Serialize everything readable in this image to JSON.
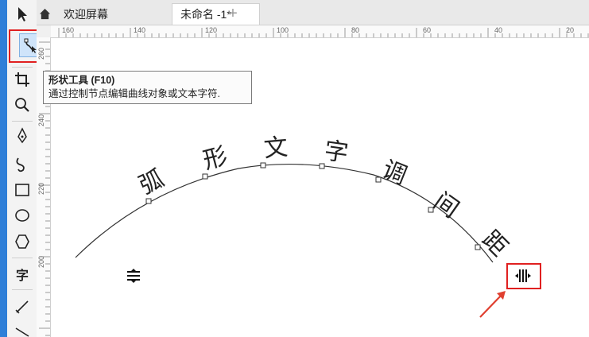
{
  "tabs": {
    "home_icon": "home-icon",
    "welcome": "欢迎屏幕",
    "untitled": "未命名 -1*",
    "add_icon": "plus-icon"
  },
  "ruler": {
    "horizontal_labels": [
      "160",
      "140",
      "120",
      "100",
      "80",
      "60",
      "40",
      "20"
    ],
    "vertical_labels": [
      "260",
      "240",
      "220",
      "200"
    ]
  },
  "tooltip": {
    "title": "形状工具 (F10)",
    "description": "通过控制节点编辑曲线对象或文本字符."
  },
  "toolbox": {
    "tools": [
      "pick-tool",
      "shape-tool",
      "crop-tool",
      "zoom-tool",
      "freehand-tool",
      "artistic-media-tool",
      "rectangle-tool",
      "ellipse-tool",
      "polygon-tool",
      "text-tool",
      "parallel-dimension-tool",
      "connector-tool"
    ],
    "text_tool_label": "字"
  },
  "curve_text": [
    "弧",
    "形",
    "文",
    "字",
    "调",
    "间",
    "距"
  ],
  "colors": {
    "accent_blue": "#2f7fd8",
    "highlight_red": "#e02020",
    "arrow_red": "#e04030"
  }
}
